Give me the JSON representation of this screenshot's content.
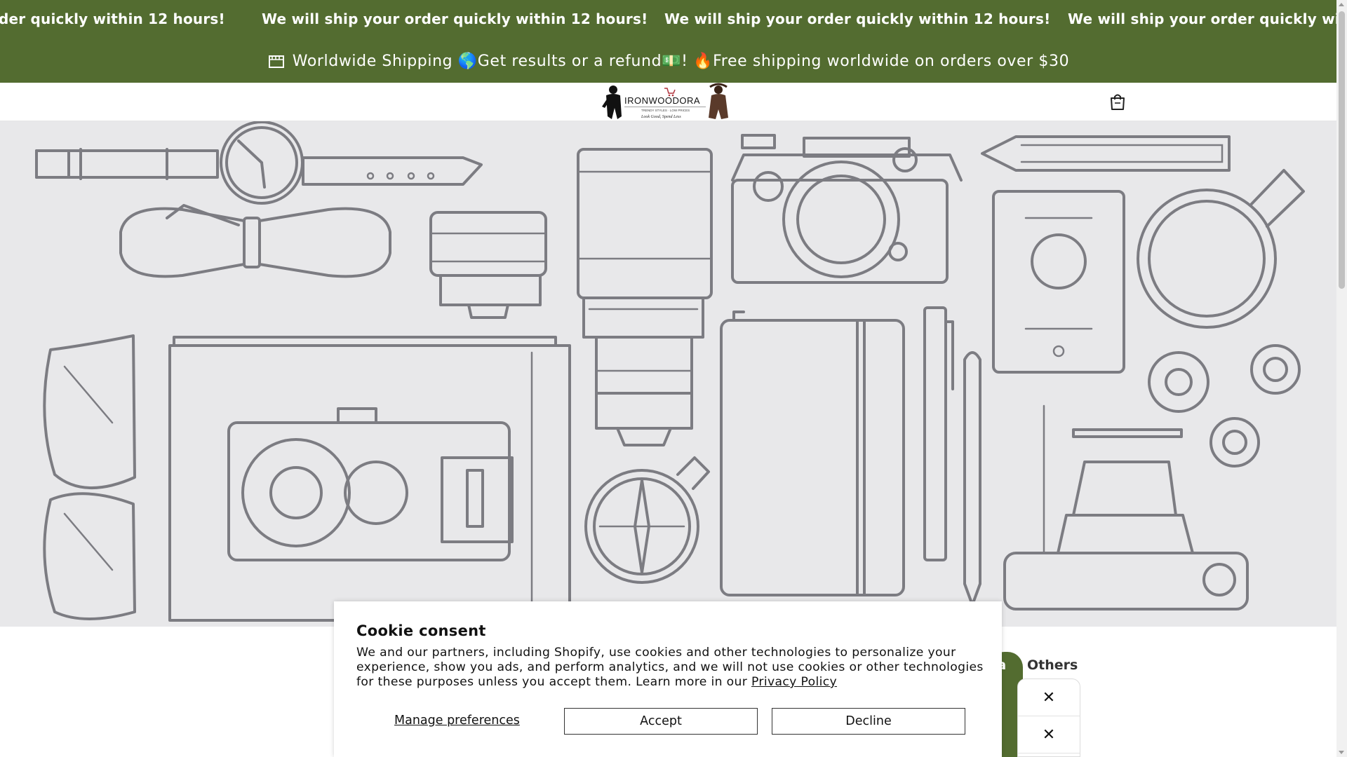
{
  "marquee": {
    "items": [
      "der quickly within 12 hours!",
      "We will ship your order quickly within 12 hours!",
      "We will ship your order quickly within 12 hours!",
      "We will ship your order quickly within"
    ]
  },
  "announcement": {
    "text": "Worldwide Shipping 🌎Get results or a refund💵! 🔥Free shipping worldwide on orders over $30",
    "icon": "store-icon"
  },
  "header": {
    "logo_text": "IRONWOODORA",
    "logo_tagline": "TRENDY STYLES · LOW PRICES",
    "logo_slogan": "Look Good, Spend Less",
    "cart_icon": "shopping-bag-icon"
  },
  "side": {
    "partial_label": "ra",
    "others_label": "Others",
    "close_glyph": "✕"
  },
  "cookie": {
    "title": "Cookie consent",
    "body": "We and our partners, including Shopify, use cookies and other technologies to personalize your experience, show you ads, and perform analytics, and we will not use cookies or other technologies for these purposes unless you accept them. Learn more in our ",
    "privacy_link": "Privacy Policy",
    "manage_label": "Manage preferences",
    "accept_label": "Accept",
    "decline_label": "Decline"
  },
  "colors": {
    "brand_green": "#536c30",
    "hero_bg": "#e8e8ea",
    "line_art": "#7c7c82"
  }
}
